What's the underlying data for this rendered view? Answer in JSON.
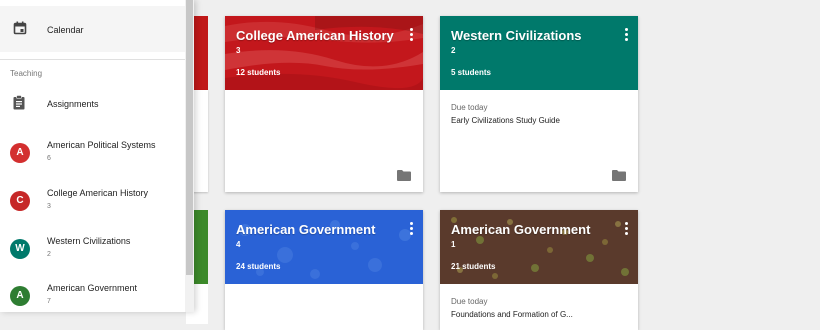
{
  "sidebar": {
    "calendar_label": "Calendar",
    "section_label": "Teaching",
    "assignments_label": "Assignments",
    "classes": [
      {
        "initial": "A",
        "name": "American Political Systems",
        "section": "6",
        "color": "#d32f2f"
      },
      {
        "initial": "C",
        "name": "College American History",
        "section": "3",
        "color": "#c62828"
      },
      {
        "initial": "W",
        "name": "Western Civilizations",
        "section": "2",
        "color": "#00796b"
      },
      {
        "initial": "A",
        "name": "American Government",
        "section": "7",
        "color": "#2e7d32"
      }
    ]
  },
  "cards": [
    {
      "title": "College American History",
      "section": "3",
      "students": "12 students",
      "due_label": "",
      "due_item": "",
      "color": "#c3171c"
    },
    {
      "title": "Western Civilizations",
      "section": "2",
      "students": "5 students",
      "due_label": "Due today",
      "due_item": "Early Civilizations Study Guide",
      "color": "#00796b"
    },
    {
      "title": "American Government",
      "section": "4",
      "students": "24 students",
      "due_label": "",
      "due_item": "",
      "color": "#2a62d6"
    },
    {
      "title": "American Government",
      "section": "1",
      "students": "21 students",
      "due_label": "Due today",
      "due_item": "Foundations and Formation of G...",
      "color": "#5a3a2c"
    }
  ],
  "icons": {
    "calendar": "calendar-icon",
    "assignments": "clipboard-icon",
    "folder": "folder-icon",
    "more": "more-vert-icon"
  }
}
